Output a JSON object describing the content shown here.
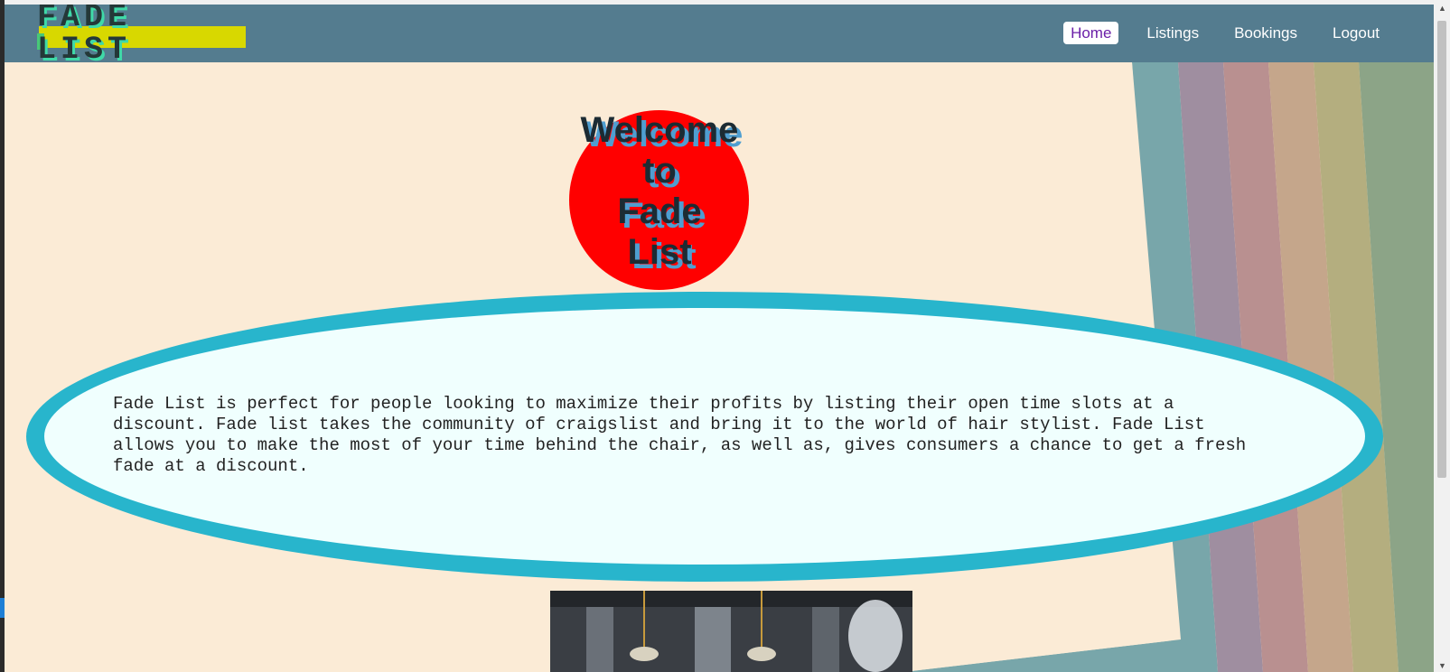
{
  "brand": {
    "logo_text": "FADE LIST"
  },
  "nav": {
    "items": [
      {
        "label": "Home",
        "active": true
      },
      {
        "label": "Listings",
        "active": false
      },
      {
        "label": "Bookings",
        "active": false
      },
      {
        "label": "Logout",
        "active": false
      }
    ]
  },
  "hero": {
    "welcome_line1": "Welcome",
    "welcome_line2": "to",
    "welcome_line3": "Fade",
    "welcome_line4": "List"
  },
  "about": {
    "text": "Fade List is perfect for people looking to maximize their profits by listing their open time slots at a discount. Fade list takes the community of craigslist and bring it to the world of hair stylist. Fade List allows you to make the most of your time behind the chair, as well as, gives consumers a chance to get a fresh fade at a discount."
  },
  "colors": {
    "navbar": "#547c8f",
    "page_background": "#fbebd6",
    "welcome_circle": "#ff0000",
    "ellipse_border": "#28b5cc",
    "ellipse_fill": "#f0fffe",
    "active_link_text": "#6b1fa8"
  },
  "icons": {
    "scroll_up": "scroll-up-arrow-icon",
    "scroll_down": "scroll-down-arrow-icon"
  }
}
